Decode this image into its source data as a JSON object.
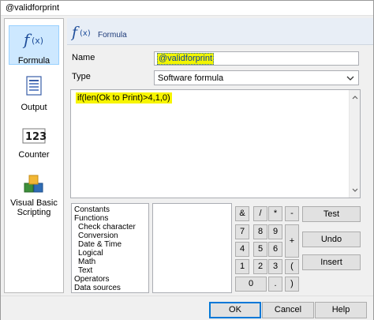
{
  "window": {
    "title": "@validforprint"
  },
  "sidebar": {
    "items": [
      {
        "label": "Formula",
        "icon": "formula-icon",
        "selected": true
      },
      {
        "label": "Output",
        "icon": "output-icon",
        "selected": false
      },
      {
        "label": "Counter",
        "icon": "counter-icon",
        "selected": false
      },
      {
        "label": "Visual Basic Scripting",
        "icon": "vb-script-icon",
        "selected": false
      }
    ]
  },
  "header": {
    "title": "Formula",
    "icon": "fx-icon",
    "icon_text": "f(x)"
  },
  "form": {
    "name_label": "Name",
    "name_value": "@validforprint",
    "type_label": "Type",
    "type_value": "Software formula"
  },
  "editor": {
    "code": "if(len(Ok to Print)>4,1,0)"
  },
  "tree": {
    "items": [
      "Constants",
      "Functions",
      "Check character",
      "Conversion",
      "Date & Time",
      "Logical",
      "Math",
      "Text",
      "Operators",
      "Data sources"
    ]
  },
  "keypad": {
    "keys": [
      "&",
      "/",
      "*",
      "-",
      "7",
      "8",
      "9",
      "+",
      "4",
      "5",
      "6",
      "1",
      "2",
      "3",
      "(",
      "0",
      ".",
      ")"
    ]
  },
  "actions": {
    "test": "Test",
    "undo": "Undo",
    "insert": "Insert"
  },
  "footer": {
    "ok": "OK",
    "cancel": "Cancel",
    "help": "Help"
  },
  "colors": {
    "highlight": "#f7f500",
    "selection": "#cde8ff",
    "header_bg": "#e8eef6"
  }
}
